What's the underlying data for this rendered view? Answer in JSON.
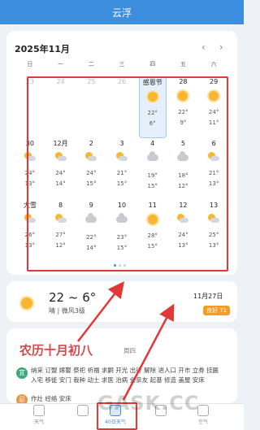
{
  "app": {
    "title": "云浮"
  },
  "calendar": {
    "month_label": "2025年11月",
    "prev": "‹",
    "next": "›",
    "weekdays": [
      "日",
      "一",
      "二",
      "三",
      "四",
      "五",
      "六"
    ],
    "days": [
      {
        "label": "23",
        "icon": "",
        "hi": "",
        "lo": "",
        "faded": true
      },
      {
        "label": "24",
        "icon": "",
        "hi": "",
        "lo": "",
        "faded": true
      },
      {
        "label": "25",
        "icon": "",
        "hi": "",
        "lo": "",
        "faded": true
      },
      {
        "label": "26",
        "icon": "",
        "hi": "",
        "lo": "",
        "faded": true
      },
      {
        "label": "感恩节",
        "icon": "sun",
        "hi": "22°",
        "lo": "6°",
        "highlight": true
      },
      {
        "label": "28",
        "icon": "sun",
        "hi": "22°",
        "lo": "9°"
      },
      {
        "label": "29",
        "icon": "sun",
        "hi": "24°",
        "lo": "11°"
      },
      {
        "label": "30",
        "icon": "partly",
        "hi": "24°",
        "lo": "13°"
      },
      {
        "label": "12月",
        "icon": "partly",
        "hi": "24°",
        "lo": "14°"
      },
      {
        "label": "2",
        "icon": "partly",
        "hi": "24°",
        "lo": "15°"
      },
      {
        "label": "3",
        "icon": "partly",
        "hi": "21°",
        "lo": "15°"
      },
      {
        "label": "4",
        "icon": "cloud",
        "hi": "19°",
        "lo": "15°"
      },
      {
        "label": "5",
        "icon": "cloud",
        "hi": "18°",
        "lo": "12°"
      },
      {
        "label": "6",
        "icon": "partly",
        "hi": "21°",
        "lo": "13°"
      },
      {
        "label": "大雪",
        "icon": "partly",
        "hi": "26°",
        "lo": "13°"
      },
      {
        "label": "8",
        "icon": "partly",
        "hi": "27°",
        "lo": "12°"
      },
      {
        "label": "9",
        "icon": "cloud",
        "hi": "22°",
        "lo": "14°"
      },
      {
        "label": "10",
        "icon": "cloud",
        "hi": "23°",
        "lo": "15°"
      },
      {
        "label": "11",
        "icon": "sun",
        "hi": "28°",
        "lo": "15°"
      },
      {
        "label": "12",
        "icon": "partly",
        "hi": "24°",
        "lo": "13°"
      },
      {
        "label": "13",
        "icon": "partly",
        "hi": "25°",
        "lo": "13°"
      }
    ]
  },
  "today": {
    "temp_range": "22 ~ 6°",
    "desc": "晴 | 微风3级",
    "date": "11月27日",
    "aqi": "良好 71"
  },
  "almanac": {
    "lunar_date": "农历十月初八",
    "weekday": "周四",
    "yi_label": "宜",
    "yi": "纳采 订盟 嫁娶 祭祀 祈福 求嗣 开光 出行 解除 进人口 开市 立券 挂匾 入宅 移徙 安门 栽种 动土 求医 治病 会亲友 起基 修造 盖屋 安床",
    "ji_label": "忌",
    "ji": "作灶 经络 安床"
  },
  "tabs": [
    {
      "label": "天气",
      "active": false
    },
    {
      "label": "",
      "active": false
    },
    {
      "label": "40日天气",
      "active": true
    },
    {
      "label": "",
      "active": false
    },
    {
      "label": "空气",
      "active": false
    }
  ],
  "watermark": "GASK.CC"
}
